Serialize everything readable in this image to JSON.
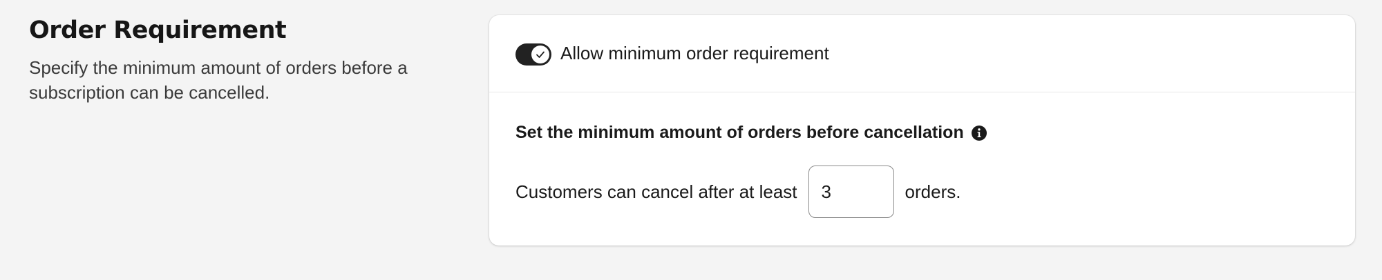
{
  "section": {
    "title": "Order Requirement",
    "description": "Specify the minimum amount of orders before a subscription can be cancelled."
  },
  "card": {
    "toggle": {
      "label": "Allow minimum order requirement",
      "checked": true,
      "icon": "checkmark-icon"
    },
    "subtitle": "Set the minimum amount of orders before cancellation",
    "info_icon": "info-icon",
    "prefix": "Customers can cancel after at least",
    "min_orders": "3",
    "suffix": "orders."
  },
  "colors": {
    "page_background": "#f4f4f4",
    "card_background": "#ffffff",
    "toggle_on": "#222222",
    "text": "#1a1a1a"
  }
}
